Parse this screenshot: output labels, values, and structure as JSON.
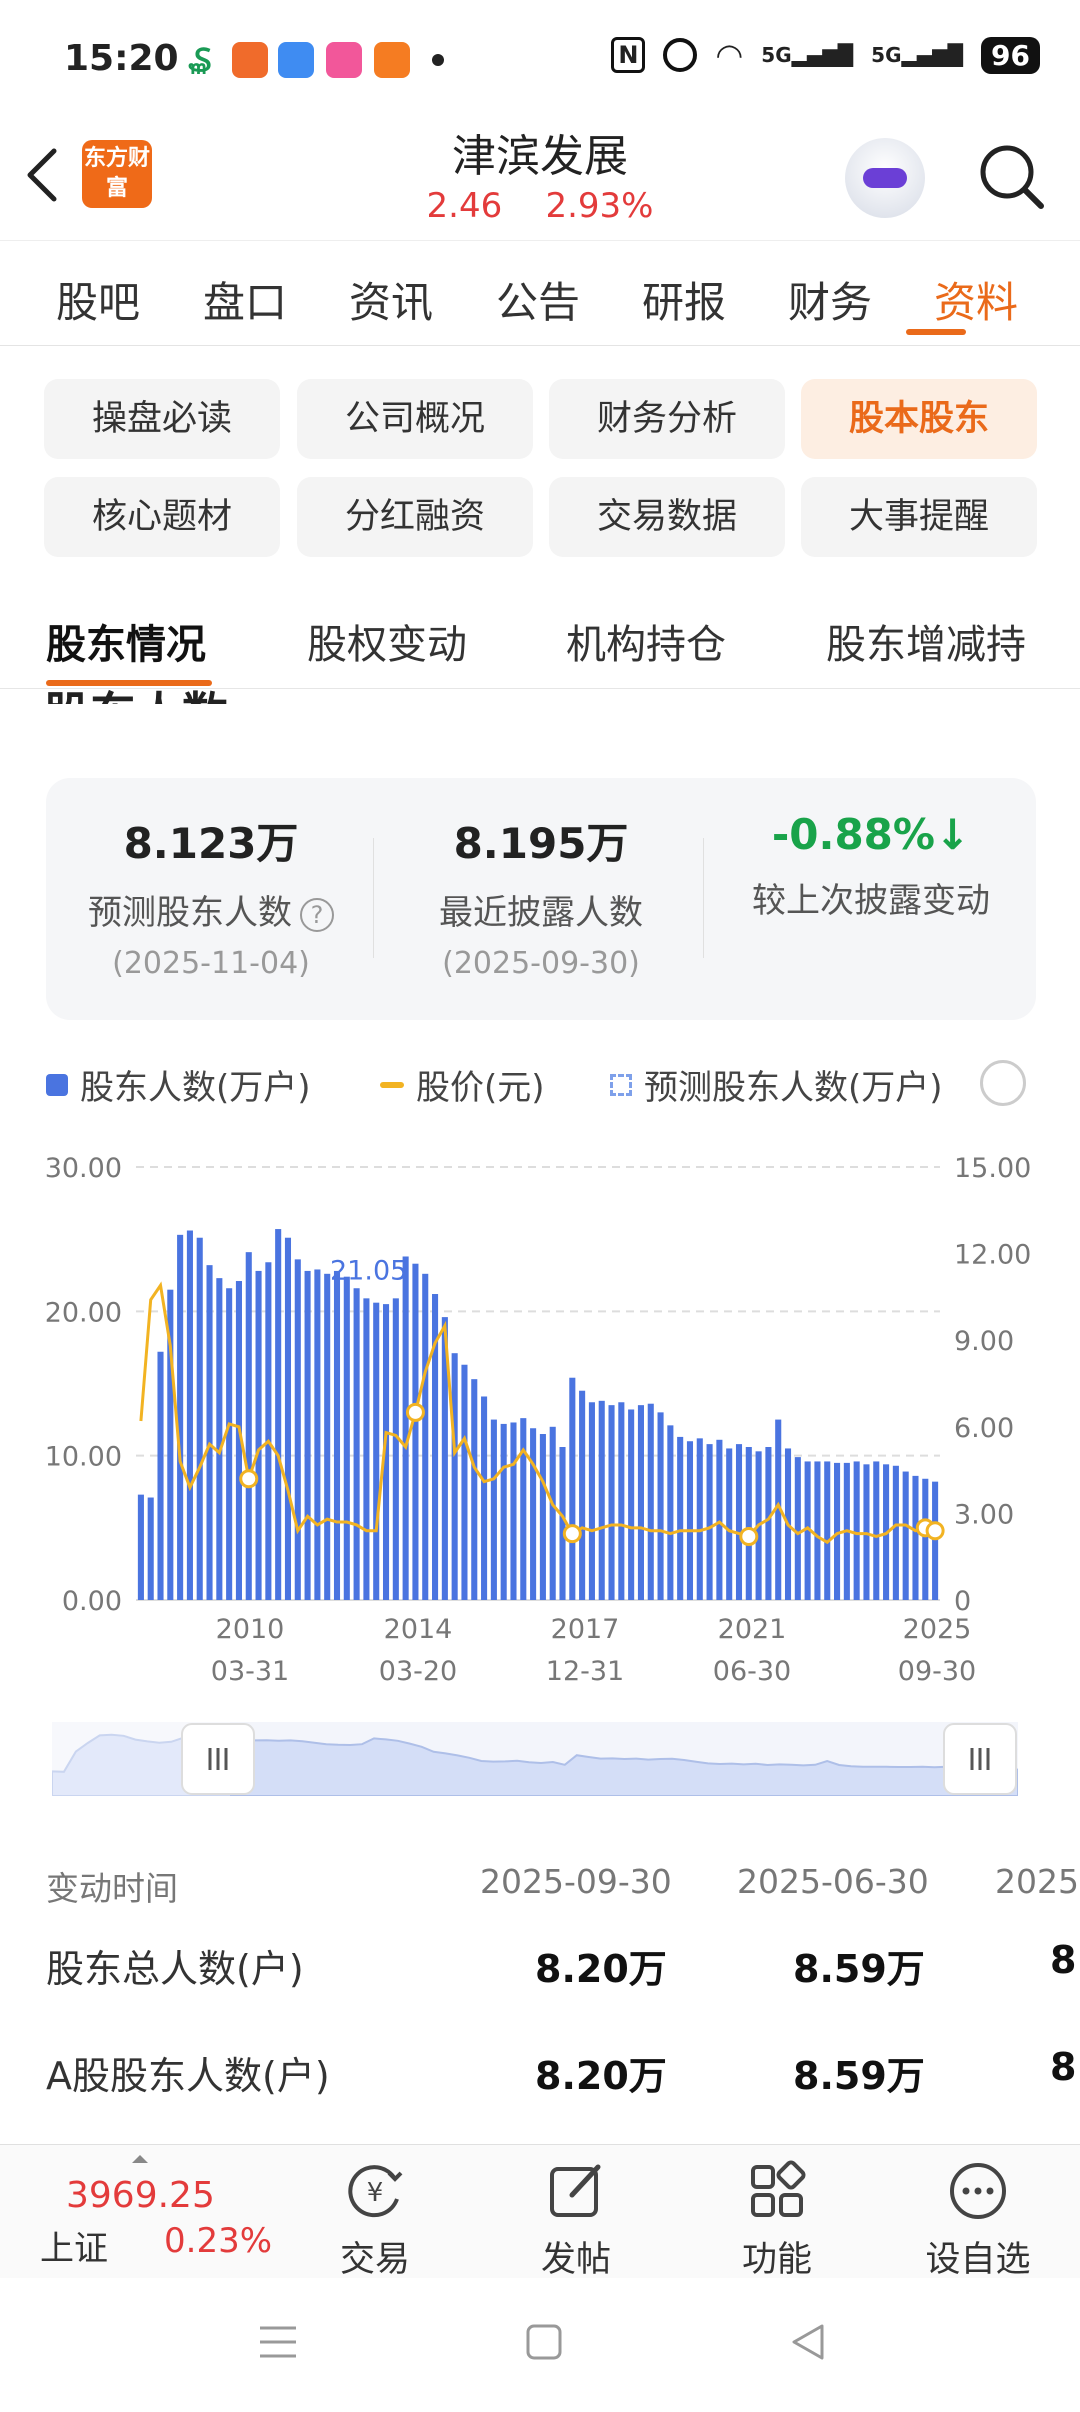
{
  "status_bar": {
    "time": "15:20",
    "battery": "96",
    "signal_1": "5G",
    "signal_2": "5G"
  },
  "header": {
    "app_logo_text": "东方财富",
    "title": "津滨发展",
    "price": "2.46",
    "change_pct": "2.93%",
    "accent_color": "#ea6a1a",
    "up_color": "#e33b3b"
  },
  "main_tabs": [
    {
      "label": "股吧"
    },
    {
      "label": "盘口"
    },
    {
      "label": "资讯"
    },
    {
      "label": "公告"
    },
    {
      "label": "研报"
    },
    {
      "label": "财务"
    },
    {
      "label": "资料"
    }
  ],
  "category_chips": [
    {
      "label": "操盘必读"
    },
    {
      "label": "公司概况"
    },
    {
      "label": "财务分析"
    },
    {
      "label": "股本股东"
    },
    {
      "label": "核心题材"
    },
    {
      "label": "分红融资"
    },
    {
      "label": "交易数据"
    },
    {
      "label": "大事提醒"
    }
  ],
  "sub_tabs": [
    {
      "label": "股东情况"
    },
    {
      "label": "股权变动"
    },
    {
      "label": "机构持仓"
    },
    {
      "label": "股东增减持"
    }
  ],
  "section_title": "股东人数",
  "stats": [
    {
      "value": "8.123万",
      "label": "预测股东人数",
      "date": "(2025-11-04)",
      "help": "?"
    },
    {
      "value": "8.195万",
      "label": "最近披露人数",
      "date": "(2025-09-30)"
    },
    {
      "value": "-0.88%",
      "label": "较上次披露变动",
      "arrow": "↓"
    }
  ],
  "legend": [
    {
      "label": "股东人数(万户)",
      "color": "#4a74e0"
    },
    {
      "label": "股价(元)",
      "color": "#f2b322"
    },
    {
      "label": "预测股东人数(万户)",
      "color": "#7ea0ea"
    }
  ],
  "chart_data": {
    "type": "bar",
    "xlabel": "",
    "ylabel": "",
    "y_left_ticks": [
      "30.00",
      "20.00",
      "10.00",
      "0.00"
    ],
    "y_right_ticks": [
      "15.00",
      "12.00",
      "9.00",
      "6.00",
      "3.00",
      "0"
    ],
    "ylim_left": [
      0,
      30
    ],
    "ylim_right": [
      0,
      15
    ],
    "x_ticks": [
      {
        "year": "2010",
        "date": "03-31"
      },
      {
        "year": "2014",
        "date": "03-20"
      },
      {
        "year": "2017",
        "date": "12-31"
      },
      {
        "year": "2021",
        "date": "06-30"
      },
      {
        "year": "2025",
        "date": "09-30"
      }
    ],
    "annotation": "21.05",
    "grid": true,
    "series": [
      {
        "name": "股东人数(万户)",
        "values": [
          7.3,
          7.1,
          17.2,
          21.5,
          25.3,
          25.6,
          25.1,
          23.2,
          22.3,
          21.6,
          22.1,
          24.1,
          22.8,
          23.4,
          25.7,
          25.1,
          23.6,
          22.8,
          22.9,
          22.6,
          22.8,
          22.4,
          21.6,
          20.9,
          20.6,
          20.5,
          20.9,
          23.8,
          23.3,
          22.6,
          21.2,
          19.6,
          17.1,
          16.3,
          15.3,
          14.1,
          12.5,
          12.2,
          12.3,
          12.6,
          11.9,
          11.5,
          12.0,
          10.6,
          15.4,
          14.5,
          13.7,
          13.8,
          13.5,
          13.7,
          13.2,
          13.5,
          13.6,
          13.0,
          12.1,
          11.3,
          11.0,
          11.2,
          10.8,
          11.1,
          10.5,
          10.8,
          10.6,
          10.3,
          10.6,
          12.5,
          10.5,
          9.9,
          9.6,
          9.6,
          9.6,
          9.5,
          9.5,
          9.6,
          9.4,
          9.6,
          9.4,
          9.3,
          8.9,
          8.6,
          8.4,
          8.2
        ]
      },
      {
        "name": "股价(元)",
        "values": [
          6.2,
          10.4,
          10.9,
          8.8,
          4.8,
          3.9,
          4.6,
          5.4,
          5.1,
          6.1,
          6.0,
          4.2,
          5.2,
          5.5,
          5.0,
          3.8,
          2.4,
          2.9,
          2.6,
          2.8,
          2.7,
          2.7,
          2.6,
          2.4,
          2.4,
          5.8,
          5.7,
          5.3,
          6.5,
          7.9,
          8.9,
          9.5,
          5.1,
          5.6,
          4.6,
          4.1,
          4.2,
          4.6,
          4.7,
          5.2,
          4.7,
          4.1,
          3.3,
          2.9,
          2.3,
          2.5,
          2.4,
          2.5,
          2.6,
          2.6,
          2.5,
          2.5,
          2.4,
          2.4,
          2.3,
          2.4,
          2.4,
          2.4,
          2.5,
          2.7,
          2.4,
          2.3,
          2.2,
          2.6,
          2.8,
          3.3,
          2.6,
          2.3,
          2.5,
          2.2,
          2.0,
          2.3,
          2.4,
          2.3,
          2.3,
          2.2,
          2.3,
          2.6,
          2.6,
          2.4,
          2.5,
          2.4
        ]
      }
    ]
  },
  "table": {
    "header_label": "变动时间",
    "columns": [
      "2025-09-30",
      "2025-06-30",
      "2025-"
    ],
    "rows": [
      {
        "label": "股东总人数(户)",
        "values": [
          "8.20万",
          "8.59万",
          "8."
        ]
      },
      {
        "label": "A股股东人数(户)",
        "values": [
          "8.20万",
          "8.59万",
          "8."
        ]
      }
    ]
  },
  "bottom_bar": {
    "index_name": "上证",
    "index_value": "3969.25",
    "index_change": "0.23%",
    "items": [
      {
        "label": "交易",
        "icon": "yen-circle-icon"
      },
      {
        "label": "发帖",
        "icon": "edit-icon"
      },
      {
        "label": "功能",
        "icon": "grid-icon"
      },
      {
        "label": "设自选",
        "icon": "more-icon"
      }
    ]
  }
}
